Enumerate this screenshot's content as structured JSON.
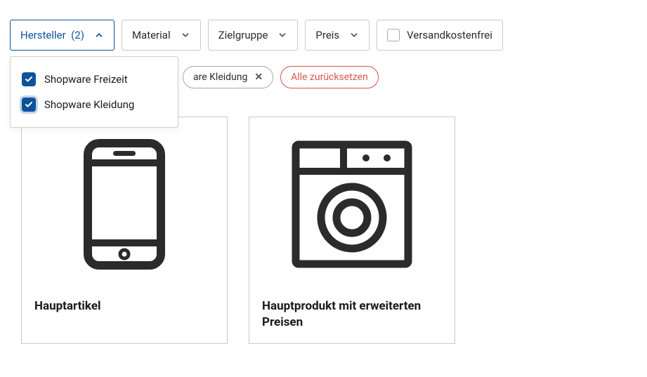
{
  "filters": {
    "hersteller": {
      "label": "Hersteller",
      "count": "(2)"
    },
    "material": {
      "label": "Material"
    },
    "zielgruppe": {
      "label": "Zielgruppe"
    },
    "preis": {
      "label": "Preis"
    },
    "versandkostenfrei": {
      "label": "Versandkostenfrei"
    }
  },
  "dropdown": {
    "items": [
      {
        "label": "Shopware Freizeit"
      },
      {
        "label": "Shopware Kleidung"
      }
    ]
  },
  "tags": {
    "visible": {
      "label": "are Kleidung"
    },
    "reset": {
      "label": "Alle zurücksetzen"
    }
  },
  "products": [
    {
      "title": "Hauptartikel"
    },
    {
      "title": "Hauptprodukt mit erweiterten Preisen"
    }
  ],
  "colors": {
    "primary": "#0b539b",
    "danger": "#d9534f",
    "icon": "#2b2b2b"
  }
}
